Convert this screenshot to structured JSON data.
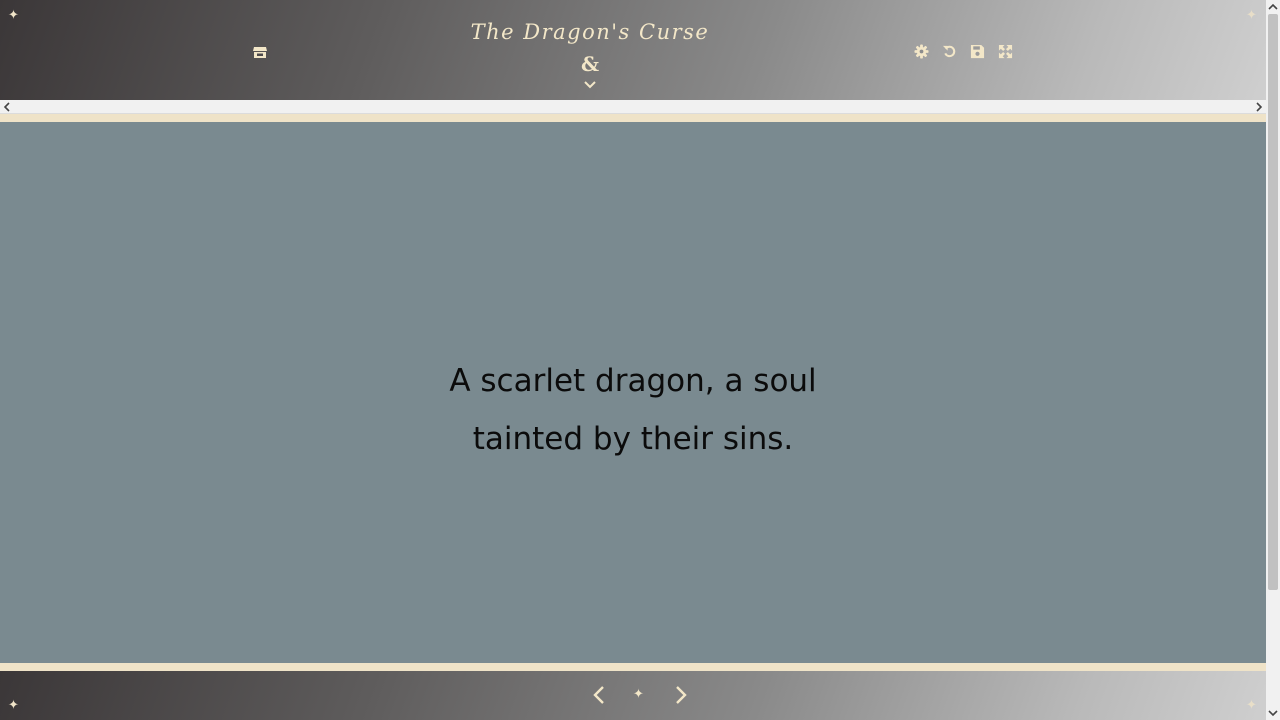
{
  "header": {
    "title": "The Dragon's Curse",
    "symbol": "&",
    "sparkle": "✦",
    "icons": [
      "store-icon",
      "gear-icon",
      "undo-icon",
      "save-icon",
      "fullscreen-icon",
      "chevron-down-icon"
    ]
  },
  "story": {
    "passage": "A scarlet dragon, a soul tainted by their sins."
  },
  "footer": {
    "center_symbol": "✦",
    "icons": [
      "chevron-left-icon",
      "chevron-right-icon"
    ]
  },
  "colors": {
    "accent": "#f3e7c8",
    "stage": "#7a8a90",
    "cream": "#efe3c8",
    "text": "#0b0b0b"
  }
}
